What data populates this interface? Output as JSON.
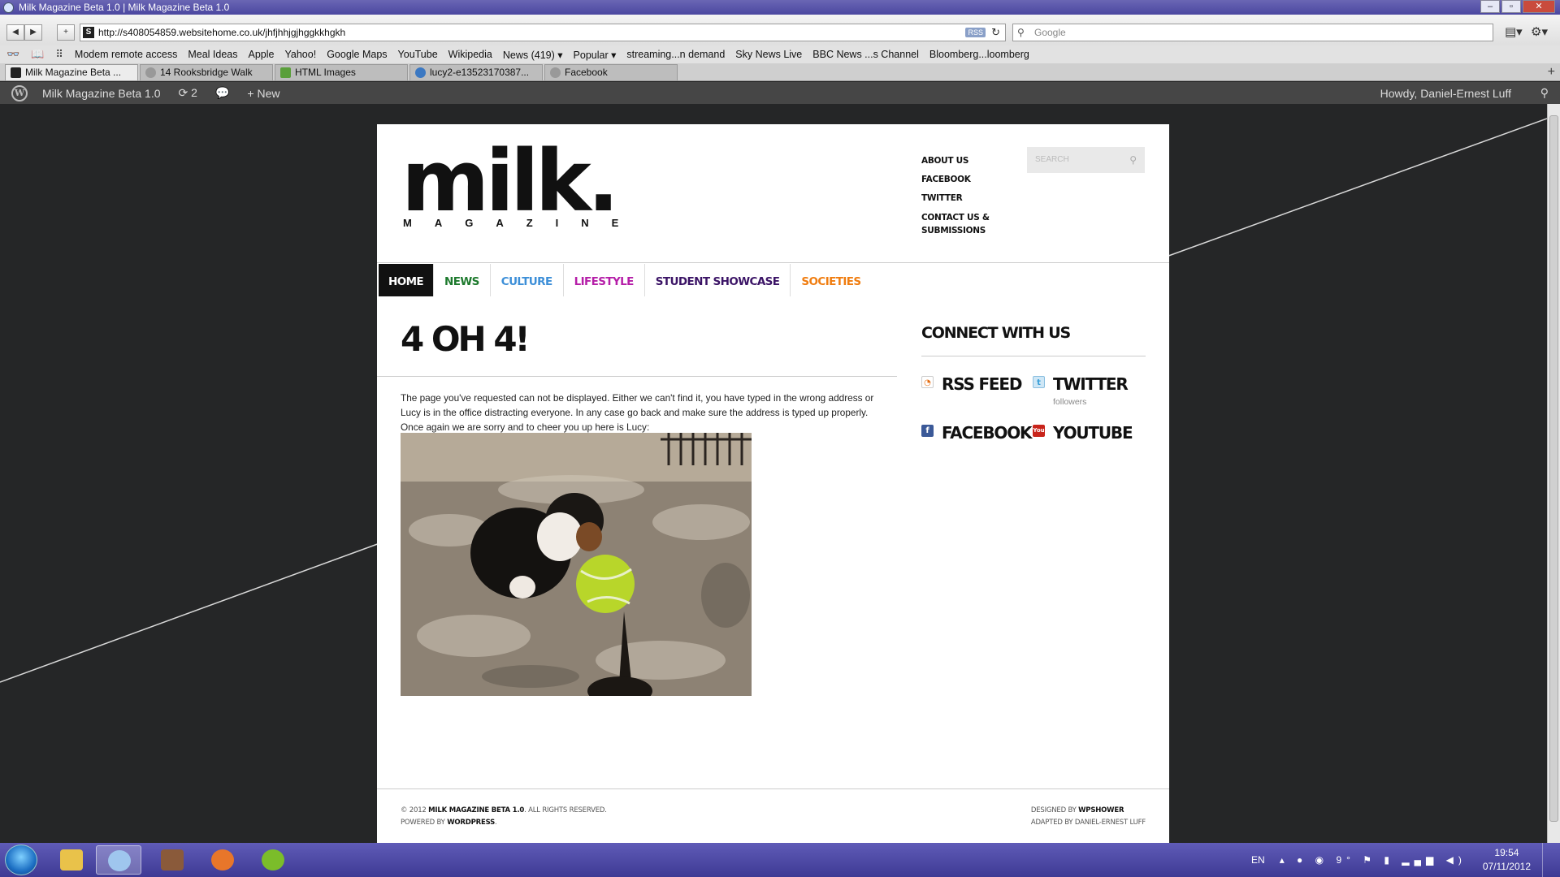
{
  "window": {
    "title": "Milk Magazine Beta 1.0 | Milk Magazine Beta 1.0"
  },
  "toolbar": {
    "url": "http://s408054859.websitehome.co.uk/jhfjhhjgjhggkkhgkh",
    "rss_badge": "RSS",
    "search_placeholder": "Google"
  },
  "bookmarks": [
    "Modem remote access",
    "Meal Ideas",
    "Apple",
    "Yahoo!",
    "Google Maps",
    "YouTube",
    "Wikipedia",
    "News (419) ▾",
    "Popular ▾",
    "streaming...n demand",
    "Sky News Live",
    "BBC News ...s Channel",
    "Bloomberg...loomberg"
  ],
  "tabs": [
    "Milk Magazine Beta ...",
    "14 Rooksbridge Walk",
    "HTML Images",
    "lucy2-e13523170387...",
    "Facebook"
  ],
  "wpbar": {
    "site": "Milk Magazine Beta 1.0",
    "updates": "2",
    "new": "New",
    "howdy": "Howdy, Daniel-Ernest Luff"
  },
  "site": {
    "logo_word": "milk.",
    "logo_sub": "MAGAZINE",
    "top_links": [
      "ABOUT US",
      "FACEBOOK",
      "TWITTER",
      "CONTACT US &",
      "SUBMISSIONS"
    ],
    "search_placeholder": "SEARCH",
    "nav": [
      {
        "label": "HOME",
        "color": "#ffffff"
      },
      {
        "label": "NEWS",
        "color": "#1e7a2e"
      },
      {
        "label": "CULTURE",
        "color": "#3d8fd8"
      },
      {
        "label": "LIFESTYLE",
        "color": "#b51ea8"
      },
      {
        "label": "STUDENT SHOWCASE",
        "color": "#3b1466"
      },
      {
        "label": "SOCIETIES",
        "color": "#f07d10"
      }
    ],
    "main_title": "4 OH 4!",
    "main_text": "The page you've requested can not be displayed. Either we can't find it, you have typed in the wrong address or Lucy is in the office distracting everyone. In any case go back and make sure the address is typed up properly. Once again we are sorry and to cheer you up here is Lucy:",
    "sidebar_title": "CONNECT WITH US",
    "social": {
      "rss": "RSS FEED",
      "twitter": "TWITTER",
      "twitter_sub": "followers",
      "facebook": "FACEBOOK",
      "youtube": "YOUTUBE"
    },
    "footer": {
      "copyright_prefix": "© 2012 ",
      "copyright_name": "MILK MAGAZINE BETA 1.0",
      "copyright_suffix": ". ALL RIGHTS RESERVED.",
      "powered_prefix": "POWERED BY ",
      "powered_name": "WORDPRESS",
      "powered_suffix": ".",
      "designed_prefix": "DESIGNED BY ",
      "designed_name": "WPSHOWER",
      "adapted": "ADAPTED BY DANIEL-ERNEST LUFF"
    }
  },
  "taskbar": {
    "lang": "EN",
    "temp": "9°",
    "time": "19:54",
    "date": "07/11/2012"
  }
}
